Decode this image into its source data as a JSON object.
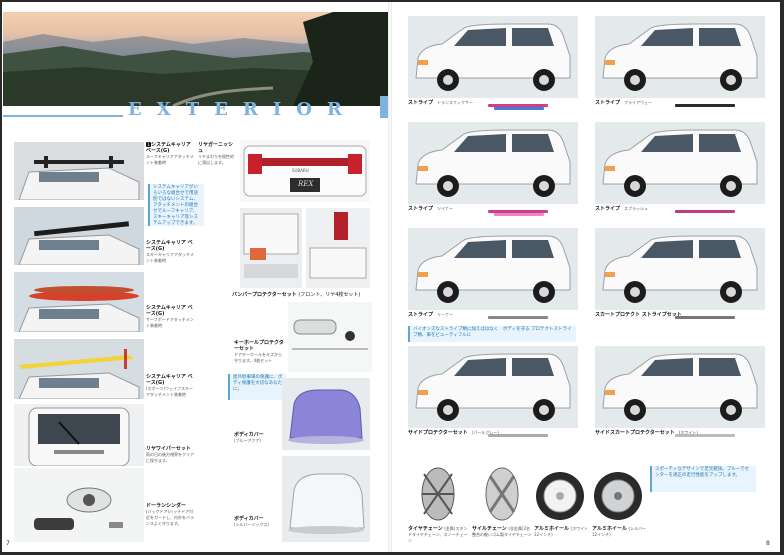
{
  "left_page": {
    "title_letters": [
      "E",
      "X",
      "T",
      "E",
      "R",
      "I",
      "O",
      "R"
    ],
    "page_number": "7",
    "items": [
      {
        "label": "システムキャリア ベース(G)",
        "sub": "ルーフキャリアアタッチメント装着時"
      },
      {
        "label": "システムキャリア ベース(G)",
        "sub": "スキーキャリアアタッチメント装着時"
      },
      {
        "label": "システムキャリア ベース(G)",
        "sub": "サーフボードアタッチメント装着時"
      },
      {
        "label": "システムキャリア ベース(G)",
        "sub": "(スポーツ)ウェイブスキーアタッチメント装着時"
      },
      {
        "label": "リヤワイパーセット",
        "sub": "雨の日の後方視界をクリアに保ちます。"
      },
      {
        "label": "ドーランシンダー",
        "sub": "(バックドア)ハッチドア付近をガードし、内外をバランスよく守ります。"
      },
      {
        "label": "リヤガーニッシュ",
        "sub": "リヤまわりを個性的に演出します。"
      },
      {
        "label": "バンパープロテクターセット",
        "sub": "(フロント、リヤ4枚セット)"
      },
      {
        "label": "キーホールプロテクターセット",
        "sub": "ドアキーホールをキズから守ります。4枚セット"
      },
      {
        "label": "ボディカバー",
        "sub": "(ブルーアクア)"
      },
      {
        "label": "ボディカバー",
        "sub": "(シルバーミックス)"
      }
    ],
    "note_carrier": "システムキャリアがいろいろな組合せで用途別ではないシステム、アタッチメントの組合せでルーフキャリア、スキーキャリア等システムアップできます。",
    "note_cover": "屋外駐車場の保護に、ボディ保護を大切なあなたに。",
    "rex_badge": "REX",
    "subaru_badge": "SUBARU"
  },
  "right_page": {
    "page_number": "8",
    "cars": [
      {
        "label": "ストライプ",
        "sub": "トランスフィクサー"
      },
      {
        "label": "ストライプ",
        "sub": "フライアウェー"
      },
      {
        "label": "ストライプ",
        "sub": "ツイナー"
      },
      {
        "label": "ストライプ",
        "sub": "スプラッシュ"
      },
      {
        "label": "ストライプ",
        "sub": "リーナー"
      },
      {
        "label": "スカートプロテクト ストライプセット",
        "sub": ""
      },
      {
        "label": "サイドプロテクターセット",
        "sub": "(パールグレー)"
      },
      {
        "label": "サイドスカートプロテクターセット",
        "sub": "(ホワイト)"
      }
    ],
    "note_stripe": "バイオンズなストライプ類に加えばはなく　ボディを守る プロテクトストライプ類、車をビューティフルに",
    "note_wheel": "スポーティなデザインで足元軽快。ブルーでセンターを適正の走行性能をアップします。",
    "wheels": [
      {
        "label": "タイヤチェーン",
        "sub": "(金属)スタンドタイヤチェーン、スノーチェーン"
      },
      {
        "label": "サイルチェーン",
        "sub": "(非金属)2名整合の軽いゴム製タイヤチェーン"
      },
      {
        "label": "アルミホイール",
        "sub": "(ホワイト12インチ)"
      },
      {
        "label": "アルミホイール",
        "sub": "(シルバー12インチ)"
      }
    ]
  },
  "colors": {
    "accent": "#7fb3dd",
    "pink": "#d23c8c",
    "blue": "#3d7fd0"
  }
}
